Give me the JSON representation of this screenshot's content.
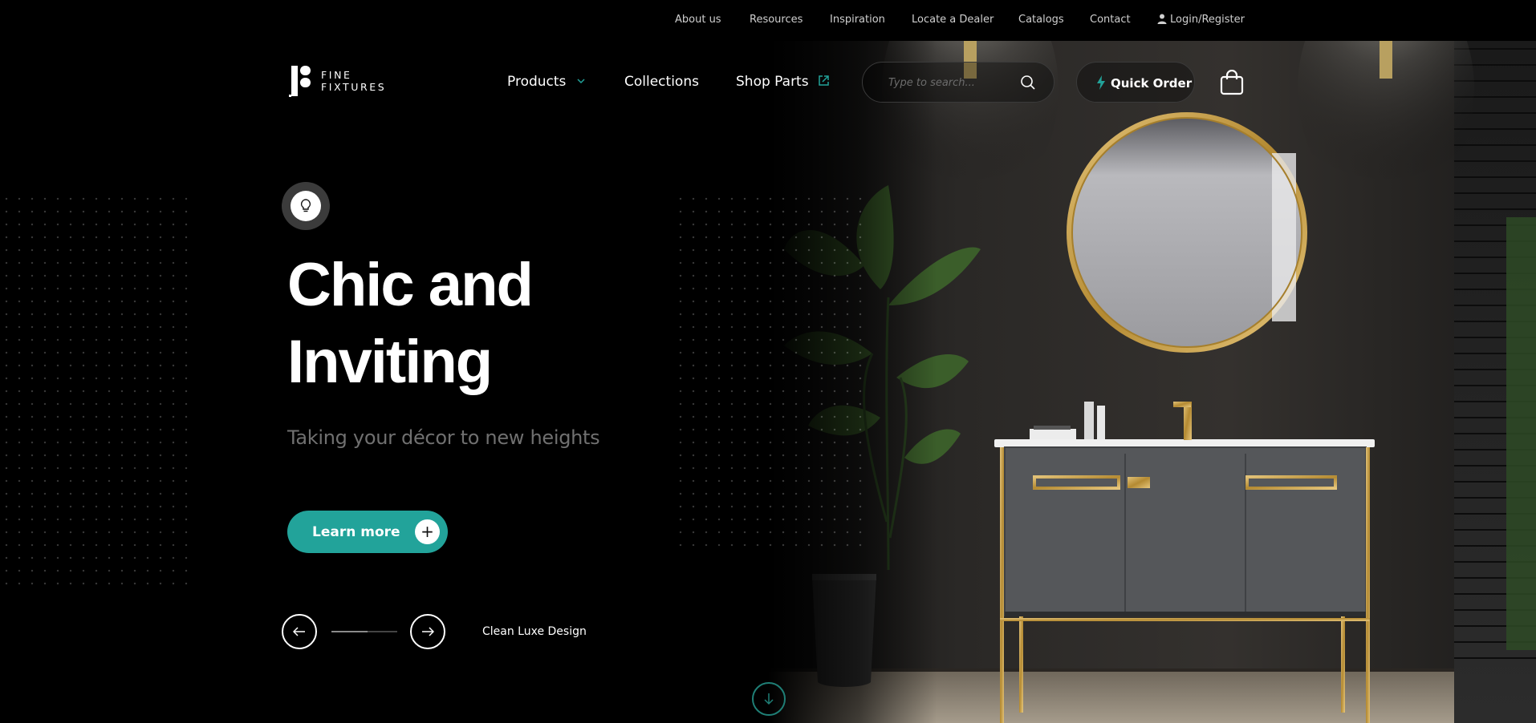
{
  "topbar": {
    "links": [
      "About us",
      "Resources",
      "Inspiration",
      "Locate a Dealer",
      "Catalogs",
      "Contact"
    ],
    "login": "Login/Register"
  },
  "logo": {
    "line1": "FINE",
    "line2": "FIXTURES"
  },
  "nav": {
    "products": "Products",
    "collections": "Collections",
    "shop_parts": "Shop Parts"
  },
  "search": {
    "placeholder": "Type to search..."
  },
  "quick_order": "Quick Order",
  "hero": {
    "title_line1": "Chic and",
    "title_line2": "Inviting",
    "subtitle": "Taking your décor to new heights",
    "cta": "Learn more",
    "cta_icon": "+",
    "slide_label": "Clean Luxe Design",
    "slider_progress": 0.55
  },
  "colors": {
    "accent": "#22a39a",
    "background": "#000000",
    "gold": "#c7a24a"
  },
  "icons": [
    "user-icon",
    "chevron-down-icon",
    "external-link-icon",
    "search-icon",
    "lightning-icon",
    "shopping-bag-icon",
    "lightbulb-icon",
    "plus-icon",
    "arrow-left-icon",
    "arrow-right-icon",
    "arrow-down-icon"
  ]
}
